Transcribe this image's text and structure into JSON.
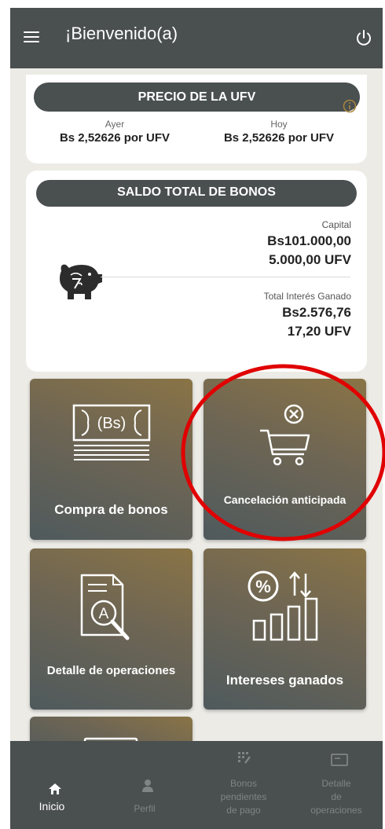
{
  "header": {
    "title": "¡Bienvenido(a)",
    "menu_icon": "hamburger-menu-icon",
    "power_icon": "power-icon"
  },
  "ufv": {
    "title": "PRECIO DE LA UFV",
    "yesterday_label": "Ayer",
    "yesterday_value": "Bs 2,52626 por UFV",
    "today_label": "Hoy",
    "today_value": "Bs 2,52626 por UFV",
    "info_icon": "info-icon"
  },
  "saldo": {
    "title": "SALDO TOTAL DE BONOS",
    "capital_label": "Capital",
    "capital_bs": "Bs101.000,00",
    "capital_ufv": "5.000,00 UFV",
    "interest_label": "Total Interés Ganado",
    "interest_bs": "Bs2.576,76",
    "interest_ufv": "17,20 UFV",
    "icon": "piggy-bank-icon"
  },
  "tiles": {
    "buy": {
      "label": "Compra de bonos",
      "icon": "money-stack-icon"
    },
    "cancel": {
      "label": "Cancelación anticipada",
      "icon": "cart-cancel-icon"
    },
    "detail": {
      "label": "Detalle de operaciones",
      "icon": "document-search-icon"
    },
    "interest": {
      "label": "Intereses ganados",
      "icon": "percent-chart-icon"
    }
  },
  "nav": {
    "home": {
      "label": "Inicio",
      "icon": "home-icon"
    },
    "profile": {
      "label": "Perfil",
      "icon": "user-icon"
    },
    "pending_line1": "Bonos",
    "pending_line2": "pendientes",
    "pending_line3": "de pago",
    "pending_icon": "pending-grid-icon",
    "detail_line1": "Detalle",
    "detail_line2": "de",
    "detail_line3": "operaciones",
    "detail_icon": "operations-card-icon"
  },
  "colors": {
    "header": "#4a4f50",
    "accent_gold": "#8a7446",
    "annotation_red": "#e00000"
  }
}
